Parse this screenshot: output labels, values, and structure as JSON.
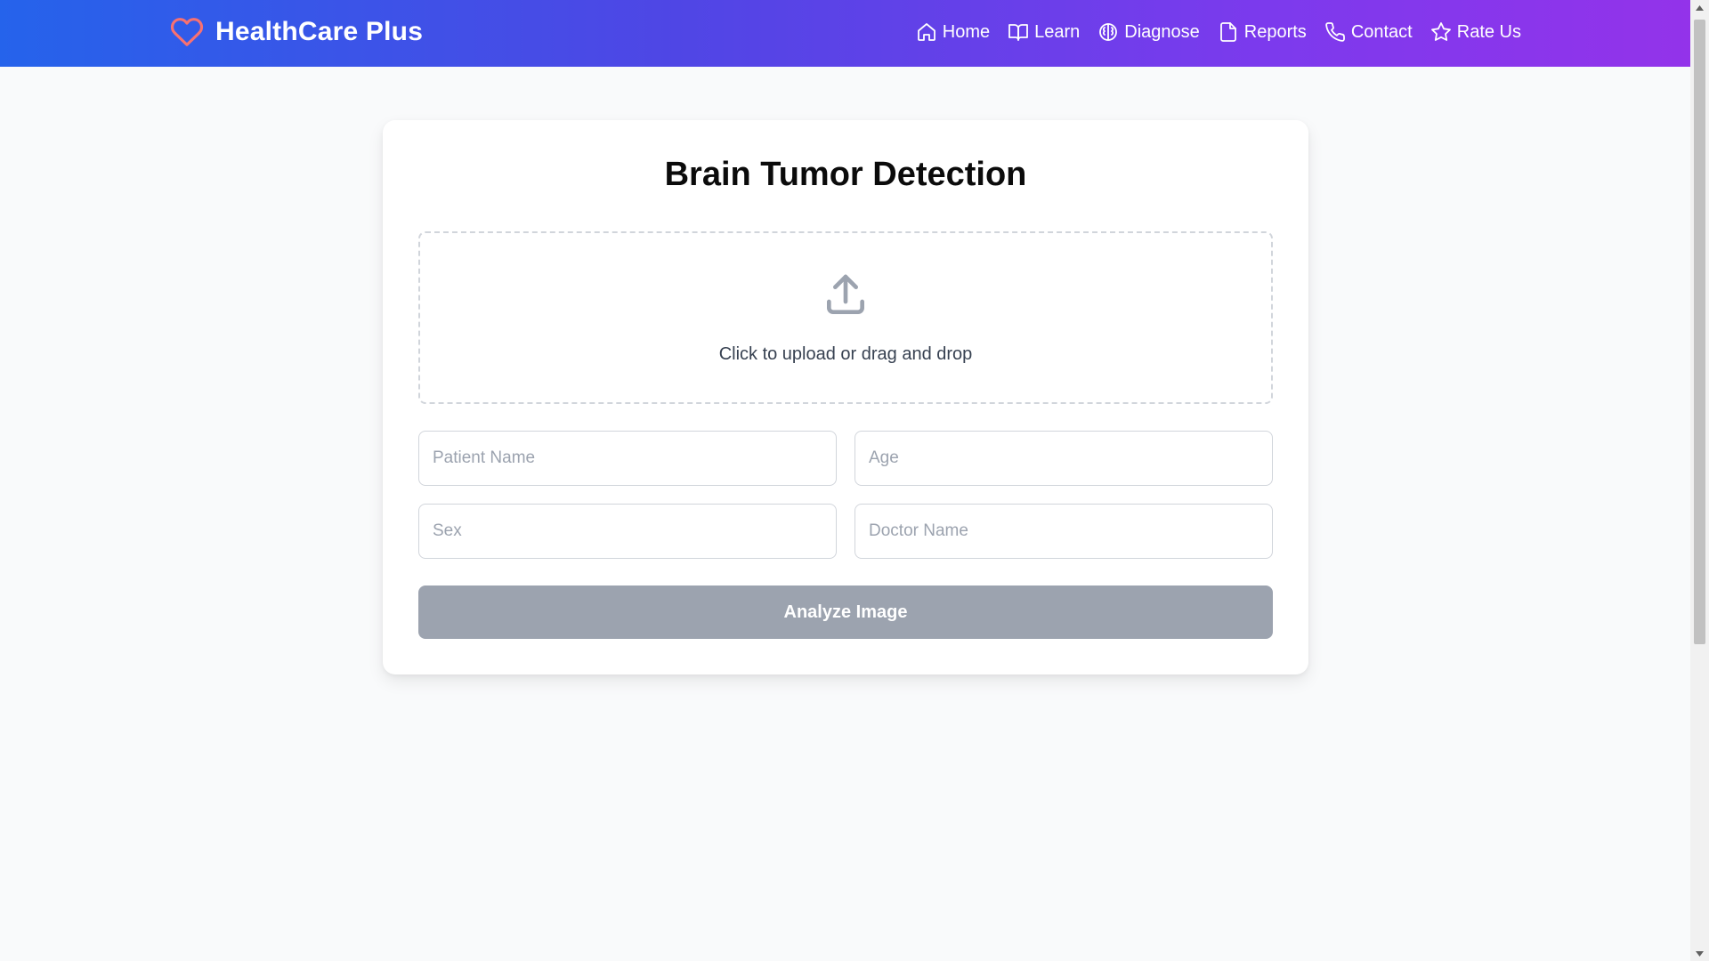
{
  "brand": {
    "name": "HealthCare Plus",
    "icon": "heart-icon",
    "icon_color": "#f87171"
  },
  "nav": {
    "items": [
      {
        "label": "Home",
        "icon": "home-icon"
      },
      {
        "label": "Learn",
        "icon": "book-open-icon"
      },
      {
        "label": "Diagnose",
        "icon": "brain-icon"
      },
      {
        "label": "Reports",
        "icon": "file-icon"
      },
      {
        "label": "Contact",
        "icon": "phone-icon"
      },
      {
        "label": "Rate Us",
        "icon": "star-icon"
      }
    ],
    "gradient_start": "#2563eb",
    "gradient_end": "#9333ea"
  },
  "card": {
    "title": "Brain Tumor Detection",
    "upload": {
      "icon": "upload-icon",
      "text": "Click to upload or drag and drop"
    },
    "fields": {
      "patient_name_placeholder": "Patient Name",
      "age_placeholder": "Age",
      "sex_placeholder": "Sex",
      "doctor_name_placeholder": "Doctor Name"
    },
    "analyze_label": "Analyze Image",
    "analyze_color": "#9ca3af"
  }
}
